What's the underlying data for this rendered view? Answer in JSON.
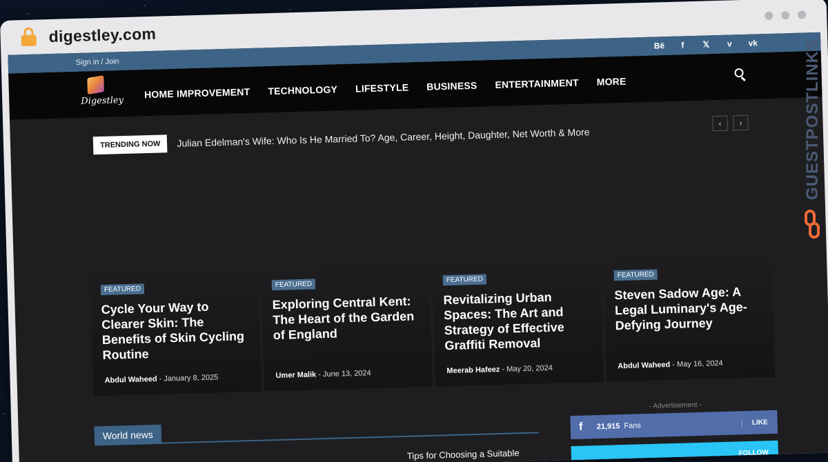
{
  "browser": {
    "url": "digestley.com"
  },
  "topbar": {
    "signin": "Sign in / Join",
    "social": [
      "Bē",
      "f",
      "𝕏",
      "v",
      "vk"
    ]
  },
  "logo": {
    "text": "Digestley"
  },
  "menu": [
    "HOME IMPROVEMENT",
    "TECHNOLOGY",
    "LIFESTYLE",
    "BUSINESS",
    "ENTERTAINMENT",
    "MORE"
  ],
  "trending": {
    "tag": "TRENDING NOW",
    "headline": "Julian Edelman's Wife: Who Is He Married To? Age, Career, Height, Daughter, Net Worth & More",
    "prev": "‹",
    "next": "›"
  },
  "cards": [
    {
      "tag": "FEATURED",
      "title": "Cycle Your Way to Clearer Skin: The Benefits of Skin Cycling Routine",
      "author": "Abdul Waheed",
      "date": "January 8, 2025"
    },
    {
      "tag": "FEATURED",
      "title": "Exploring Central Kent: The Heart of the Garden of England",
      "author": "Umer Malik",
      "date": "June 13, 2024"
    },
    {
      "tag": "FEATURED",
      "title": "Revitalizing Urban Spaces: The Art and Strategy of Effective Graffiti Removal",
      "author": "Meerab Hafeez",
      "date": "May 20, 2024"
    },
    {
      "tag": "FEATURED",
      "title": "Steven Sadow Age: A Legal Luminary's Age-Defying Journey",
      "author": "Abdul Waheed",
      "date": "May 16, 2024"
    }
  ],
  "world": {
    "label": "World news",
    "item": "Tips for Choosing a Suitable"
  },
  "sidebar": {
    "ad": "- Advertisement -",
    "facebook": {
      "icon": "f",
      "count": "21,915",
      "unit": "Fans",
      "action": "LIKE"
    },
    "twitter": {
      "action": "FOLLOW"
    }
  },
  "watermark": {
    "text": "GUESTPOSTLINKS"
  }
}
